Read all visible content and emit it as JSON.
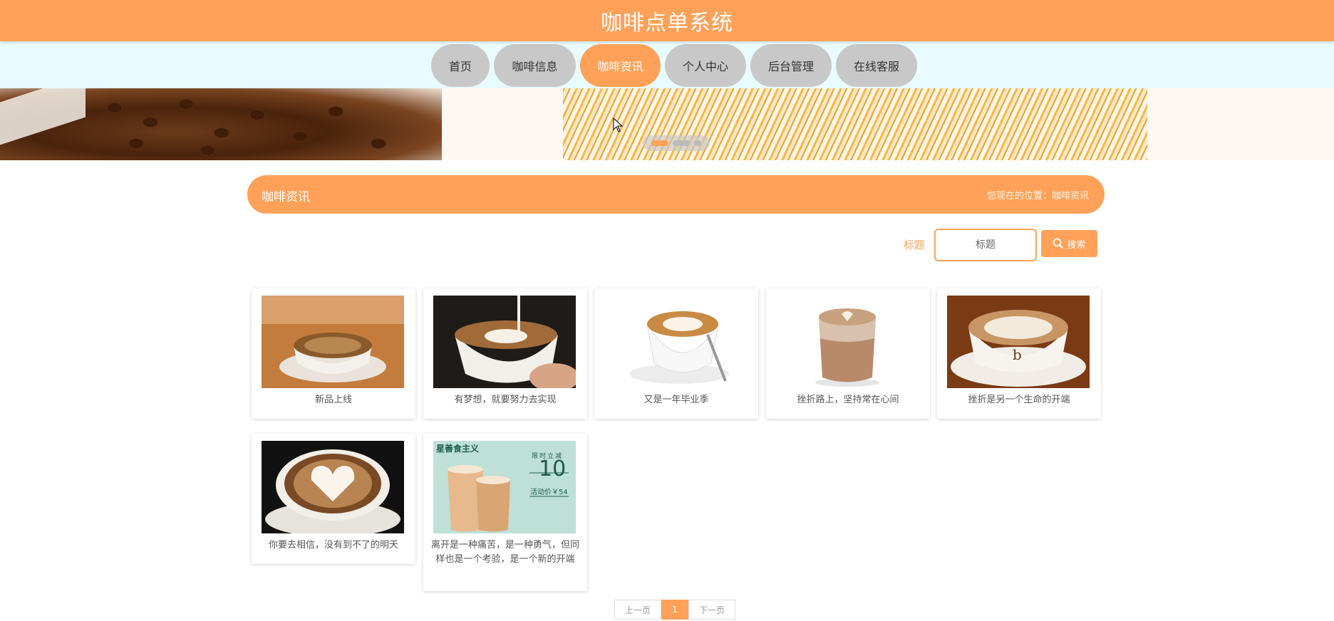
{
  "header": {
    "title": "咖啡点单系统"
  },
  "nav": [
    {
      "label": "首页"
    },
    {
      "label": "咖啡信息"
    },
    {
      "label": "咖啡资讯",
      "active": true
    },
    {
      "label": "个人中心"
    },
    {
      "label": "后台管理"
    },
    {
      "label": "在线客服"
    }
  ],
  "banner": {
    "slides": 3,
    "active_index": 0
  },
  "section": {
    "title": "咖啡资讯",
    "breadcrumb": "您现在的位置：咖啡资讯"
  },
  "search": {
    "label": "标题",
    "placeholder": "标题",
    "button_label": "搜索"
  },
  "articles": [
    {
      "title": "新品上线",
      "image": "latte-cup-on-wood-table"
    },
    {
      "title": "有梦想，就要努力去实现",
      "image": "latte-art-pouring"
    },
    {
      "title": "又是一年毕业季",
      "image": "white-cup-with-spoon"
    },
    {
      "title": "挫折路上，坚持常在心间",
      "image": "glass-mocha-heart"
    },
    {
      "title": "挫折是另一个生命的开端",
      "image": "cappuccino-branded-cup"
    },
    {
      "title": "你要去相信，没有到不了的明天",
      "image": "heart-latte-art-dark"
    },
    {
      "title": "离开是一种痛苦，是一种勇气，但同样也是一个考验，是一个新的开端",
      "image": "promo-two-cups",
      "promo": {
        "brand": "星善食主义",
        "tag": "限时立减",
        "amount": "10",
        "price": "活动价￥54"
      }
    }
  ],
  "pagination": {
    "prev": "上一页",
    "current": "1",
    "next": "下一页"
  },
  "colors": {
    "accent": "#ffa158",
    "nav_bg": "#e8fbff",
    "nav_item": "#c8c8c8"
  }
}
